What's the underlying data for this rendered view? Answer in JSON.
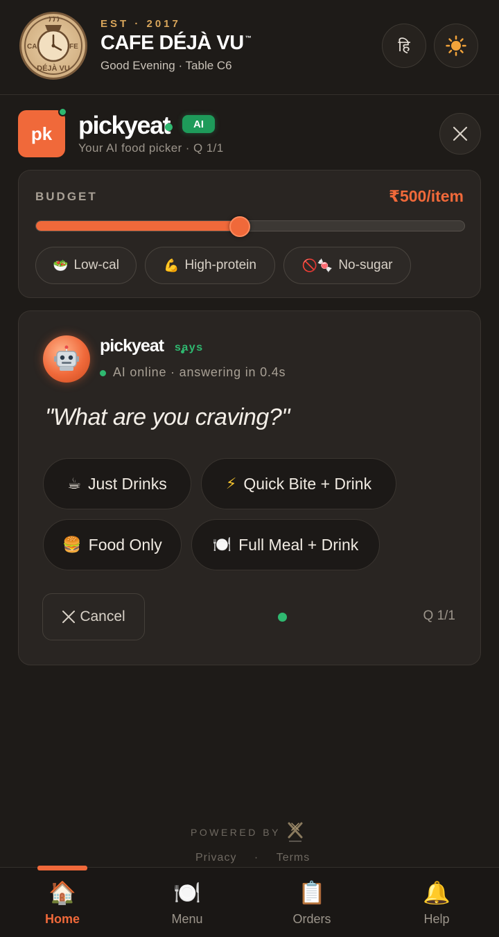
{
  "header": {
    "est": "EST · 2017",
    "brand": "CAFE DÉJÀ VU",
    "brand_tm": "™",
    "greeting": "Good Evening · Table C6",
    "logo_text_top_left": "CA",
    "logo_text_top_right": "FE",
    "logo_text_bottom": "DÉJÀ VU",
    "language_button": "हि",
    "theme_icon": "sun-icon"
  },
  "pickyeat": {
    "logo_text": "pk",
    "title": "pickyeat",
    "badge": "AI",
    "subtitle": "Your AI food picker · Q 1/1"
  },
  "budget": {
    "label": "BUDGET",
    "value_text": "₹500/item",
    "slider_fraction": 0.475,
    "chips": [
      {
        "emoji": "🥗",
        "label": "Low-cal"
      },
      {
        "emoji": "💪",
        "label": "High-protein"
      },
      {
        "emoji": "🚫🍬",
        "label": "No-sugar"
      }
    ]
  },
  "chat": {
    "name": "pickyeat",
    "says": "says",
    "status": "AI online · answering in 0.4s",
    "question": "\"What are you craving?\"",
    "options": [
      {
        "emoji": "☕",
        "label": "Just Drinks"
      },
      {
        "emoji": "⚡",
        "label": "Quick Bite + Drink"
      },
      {
        "emoji": "🍔",
        "label": "Food Only"
      },
      {
        "emoji": "🍽️",
        "label": "Full Meal + Drink"
      }
    ],
    "cancel": "Cancel",
    "question_counter": "Q 1/1"
  },
  "footer": {
    "powered_by": "POWERED BY",
    "privacy": "Privacy",
    "separator": "·",
    "terms": "Terms"
  },
  "nav": {
    "items": [
      {
        "icon": "🏠",
        "label": "Home"
      },
      {
        "icon": "🍽️",
        "label": "Menu"
      },
      {
        "icon": "📋",
        "label": "Orders"
      },
      {
        "icon": "🔔",
        "label": "Help"
      }
    ],
    "active": "Home"
  },
  "colors": {
    "accent": "#f0693a",
    "online": "#2fb870",
    "background": "#1e1b18",
    "card": "#292522"
  }
}
